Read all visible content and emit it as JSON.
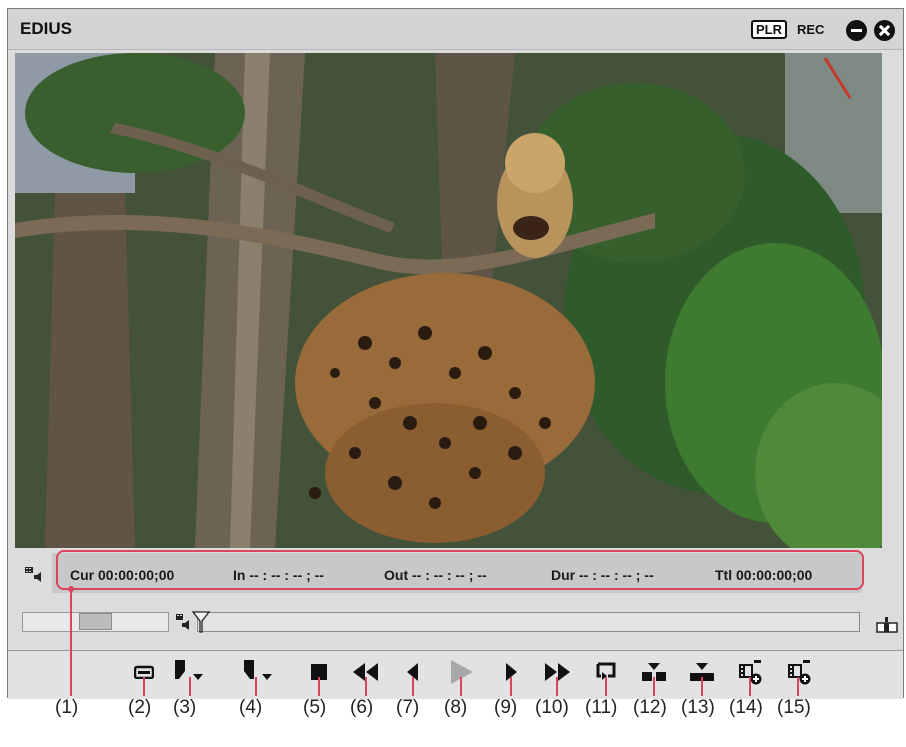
{
  "window": {
    "title": "EDIUS",
    "plr_label": "PLR",
    "rec_label": "REC"
  },
  "timecode": {
    "cur": "Cur 00:00:00;00",
    "in": "In -- : -- : -- ; --",
    "out": "Out -- : -- : -- ; --",
    "dur": "Dur -- : -- : -- ; --",
    "ttl": "Ttl 00:00:00;00"
  },
  "icons": {
    "minimize": "minimize-icon",
    "close": "close-icon",
    "video_audio": "video-audio-icon",
    "playhead": "playhead-icon",
    "dock": "dock-icon",
    "snapshot": "snapshot-icon",
    "set_in": "set-in-icon",
    "set_out": "set-out-icon",
    "stop": "stop-icon",
    "rewind": "rewind-icon",
    "prev_frame": "prev-frame-icon",
    "play": "play-icon",
    "next_frame": "next-frame-icon",
    "fast_forward": "fast-forward-icon",
    "loop": "loop-icon",
    "insert": "insert-to-timeline-icon",
    "overwrite": "overwrite-to-timeline-icon",
    "add_bin": "add-to-bin-icon",
    "add_sequence": "add-to-sequence-icon"
  },
  "colors": {
    "accent_callout": "#d9455c",
    "panel": "#dcdcdc"
  },
  "callouts": [
    "(1)",
    "(2)",
    "(3)",
    "(4)",
    "(5)",
    "(6)",
    "(7)",
    "(8)",
    "(9)",
    "(10)",
    "(11)",
    "(12)",
    "(13)",
    "(14)",
    "(15)"
  ]
}
